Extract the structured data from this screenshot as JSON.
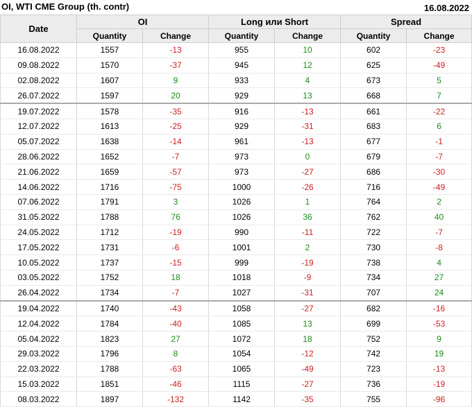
{
  "header": {
    "title": "OI, WTI CME Group (th. contr)",
    "date": "16.08.2022"
  },
  "table": {
    "date_header": "Date",
    "groups": [
      "OI",
      "Long или Short",
      "Spread"
    ],
    "sub_headers": [
      "Quantity",
      "Change",
      "Quantity",
      "Change",
      "Quantity",
      "Change"
    ],
    "rows": [
      [
        "16.08.2022",
        "1557",
        "-13",
        "955",
        "10",
        "602",
        "-23"
      ],
      [
        "09.08.2022",
        "1570",
        "-37",
        "945",
        "12",
        "625",
        "-49"
      ],
      [
        "02.08.2022",
        "1607",
        "9",
        "933",
        "4",
        "673",
        "5"
      ],
      [
        "26.07.2022",
        "1597",
        "20",
        "929",
        "13",
        "668",
        "7"
      ],
      [
        "19.07.2022",
        "1578",
        "-35",
        "916",
        "-13",
        "661",
        "-22"
      ],
      [
        "12.07.2022",
        "1613",
        "-25",
        "929",
        "-31",
        "683",
        "6"
      ],
      [
        "05.07.2022",
        "1638",
        "-14",
        "961",
        "-13",
        "677",
        "-1"
      ],
      [
        "28.06.2022",
        "1652",
        "-7",
        "973",
        "0",
        "679",
        "-7"
      ],
      [
        "21.06.2022",
        "1659",
        "-57",
        "973",
        "-27",
        "686",
        "-30"
      ],
      [
        "14.06.2022",
        "1716",
        "-75",
        "1000",
        "-26",
        "716",
        "-49"
      ],
      [
        "07.06.2022",
        "1791",
        "3",
        "1026",
        "1",
        "764",
        "2"
      ],
      [
        "31.05.2022",
        "1788",
        "76",
        "1026",
        "36",
        "762",
        "40"
      ],
      [
        "24.05.2022",
        "1712",
        "-19",
        "990",
        "-11",
        "722",
        "-7"
      ],
      [
        "17.05.2022",
        "1731",
        "-6",
        "1001",
        "2",
        "730",
        "-8"
      ],
      [
        "10.05.2022",
        "1737",
        "-15",
        "999",
        "-19",
        "738",
        "4"
      ],
      [
        "03.05.2022",
        "1752",
        "18",
        "1018",
        "-9",
        "734",
        "27"
      ],
      [
        "26.04.2022",
        "1734",
        "-7",
        "1027",
        "-31",
        "707",
        "24"
      ],
      [
        "19.04.2022",
        "1740",
        "-43",
        "1058",
        "-27",
        "682",
        "-16"
      ],
      [
        "12.04.2022",
        "1784",
        "-40",
        "1085",
        "13",
        "699",
        "-53"
      ],
      [
        "05.04.2022",
        "1823",
        "27",
        "1072",
        "18",
        "752",
        "9"
      ],
      [
        "29.03.2022",
        "1796",
        "8",
        "1054",
        "-12",
        "742",
        "19"
      ],
      [
        "22.03.2022",
        "1788",
        "-63",
        "1065",
        "-49",
        "723",
        "-13"
      ],
      [
        "15.03.2022",
        "1851",
        "-46",
        "1115",
        "-27",
        "736",
        "-19"
      ],
      [
        "08.03.2022",
        "1897",
        "-132",
        "1142",
        "-35",
        "755",
        "-96"
      ]
    ]
  },
  "colors": {
    "positive": "#1a8c1a",
    "negative": "#cc1f1f",
    "header_bg": "#ececec"
  }
}
